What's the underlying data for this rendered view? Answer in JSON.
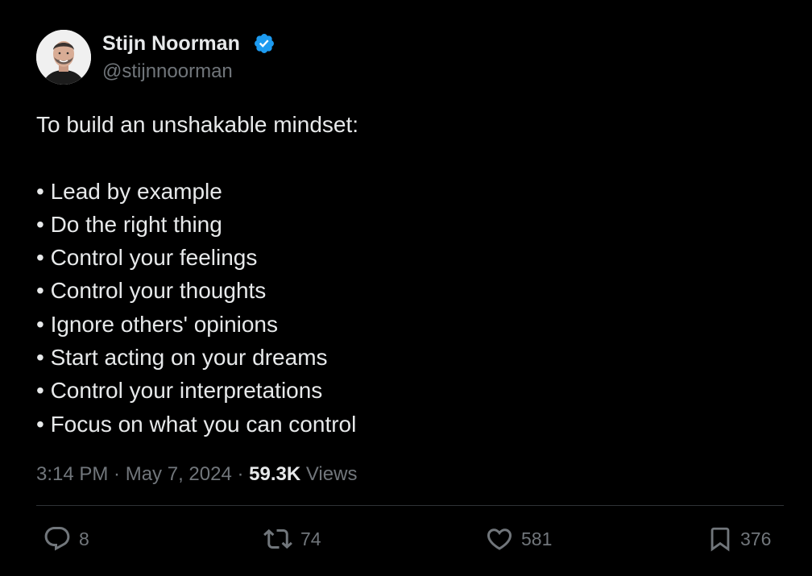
{
  "author": {
    "display_name": "Stijn Noorman",
    "handle": "@stijnnoorman",
    "verified_color": "#1d9bf0",
    "avatar_icon": "profile-photo"
  },
  "tweet": {
    "intro": "To build an unshakable mindset:",
    "bullets": [
      "• Lead by example",
      "• Do the right thing",
      "• Control your feelings",
      "• Control your thoughts",
      "• Ignore others' opinions",
      "• Start acting on your dreams",
      "• Control your interpretations",
      "• Focus on what you can control"
    ]
  },
  "meta": {
    "time": "3:14 PM",
    "separator": " · ",
    "date": "May 7, 2024",
    "views_count": "59.3K",
    "views_label": "Views"
  },
  "actions": {
    "replies": "8",
    "reposts": "74",
    "likes": "581",
    "bookmarks": "376"
  },
  "colors": {
    "background": "#000000",
    "text": "#e7e9ea",
    "secondary_text": "#71767b",
    "divider": "#2f3336",
    "verified": "#1d9bf0"
  }
}
